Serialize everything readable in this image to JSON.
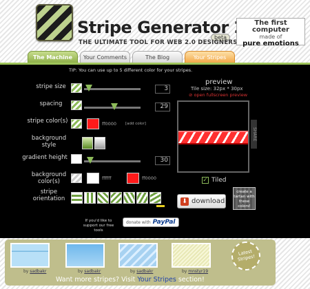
{
  "header": {
    "title": "Stripe Generator 2.0",
    "beta": "beta",
    "tagline": "THE ULTIMATE TOOL FOR WEB 2.0 DESIGNERS",
    "ad": {
      "line1": "The first computer",
      "line2": "made of",
      "line3": "pure emotions"
    }
  },
  "tabs": [
    "The Machine",
    "Your Comments",
    "The Blog",
    "Your Stripes"
  ],
  "tip": "TIP: You can use up to 5 different color for your stripes.",
  "controls": {
    "stripe_size": {
      "label": "stripe size",
      "value": "3"
    },
    "spacing": {
      "label": "spacing",
      "value": "29"
    },
    "stripe_colors": {
      "label": "stripe color(s)",
      "hex": "ff0000",
      "add": "[add color]",
      "color": "#ff1a1a"
    },
    "background_style": {
      "label": "background style"
    },
    "gradient_height": {
      "label": "gradient height",
      "value": "30"
    },
    "background_colors": {
      "label": "background color(s)",
      "hex1": "ffffff",
      "hex2": "ff0000"
    },
    "stripe_orientation": {
      "label": "stripe orientation"
    }
  },
  "preview": {
    "title": "preview",
    "tile_size": "Tile size: 32px * 30px",
    "open_full": "open fullscreen preview",
    "share": "SHARE",
    "tiled": "Tiled"
  },
  "download": {
    "label": "download"
  },
  "tartan": {
    "text": "create a tartan with these colors!"
  },
  "support": {
    "text": "If you'd like to support our free tools",
    "paypal_prefix": "donate with",
    "paypal_brand": "PayPal"
  },
  "latest": {
    "badge": "Latest Stripes!",
    "items": [
      {
        "by": "by",
        "author": "sadbakr"
      },
      {
        "by": "by",
        "author": "sadbakr"
      },
      {
        "by": "by",
        "author": "sadbakr"
      },
      {
        "by": "by",
        "author": "mnstyr19"
      }
    ],
    "more_prefix": "Want more stripes? Visit ",
    "more_link": "Your Stripes",
    "more_suffix": " section!"
  }
}
